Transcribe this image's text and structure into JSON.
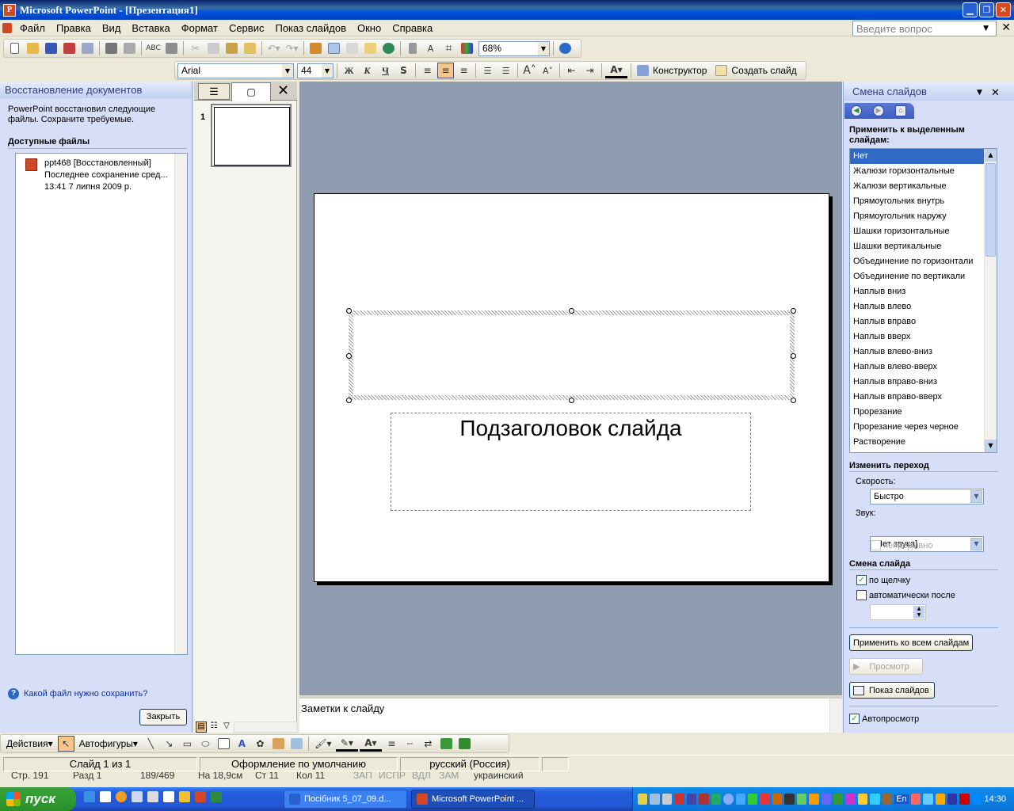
{
  "window": {
    "title": "Microsoft PowerPoint - [Презентация1]",
    "icon": "powerpoint-icon"
  },
  "menu": [
    "Файл",
    "Правка",
    "Вид",
    "Вставка",
    "Формат",
    "Сервис",
    "Показ слайдов",
    "Окно",
    "Справка"
  ],
  "ask": {
    "placeholder": "Введите вопрос"
  },
  "standard_toolbar": {
    "zoom": "68%"
  },
  "format_toolbar": {
    "font": "Arial",
    "size": "44",
    "bold": "Ж",
    "italic": "К",
    "underline": "Ч",
    "shadow": "S",
    "designer": "Конструктор",
    "new_slide": "Создать слайд"
  },
  "recovery": {
    "title": "Восстановление документов",
    "message": "PowerPoint восстановил следующие файлы. Сохраните требуемые.",
    "files_heading": "Доступные файлы",
    "file": {
      "name": "ppt468  [Восстановленный]",
      "line2": "Последнее сохранение сред...",
      "line3": "13:41 7 липня 2009 р."
    },
    "help_link": "Какой файл нужно сохранить?",
    "close": "Закрыть"
  },
  "slides_tab": {
    "slide_number": "1"
  },
  "slide": {
    "subtitle": "Подзаголовок слайда"
  },
  "notes": {
    "placeholder": "Заметки к слайду"
  },
  "transition": {
    "title": "Смена слайдов",
    "apply_heading": "Применить к выделенным слайдам:",
    "effects": [
      "Нет",
      "Жалюзи горизонтальные",
      "Жалюзи вертикальные",
      "Прямоугольник внутрь",
      "Прямоугольник наружу",
      "Шашки горизонтальные",
      "Шашки вертикальные",
      "Объединение по горизонтали",
      "Объединение по вертикали",
      "Наплыв вниз",
      "Наплыв влево",
      "Наплыв вправо",
      "Наплыв вверх",
      "Наплыв влево-вниз",
      "Наплыв влево-вверх",
      "Наплыв вправо-вниз",
      "Наплыв вправо-вверх",
      "Прорезание",
      "Прорезание через черное",
      "Растворение"
    ],
    "selected_effect": "Нет",
    "modify_heading": "Изменить переход",
    "speed_label": "Скорость:",
    "speed": "Быстро",
    "sound_label": "Звук:",
    "sound": "[Нет звука]",
    "loop_label": "непрерывно",
    "advance_heading": "Смена слайда",
    "on_click_label": "по щелчку",
    "on_click": true,
    "auto_label": "автоматически после",
    "auto": false,
    "apply_all": "Применить ко всем слайдам",
    "preview": "Просмотр",
    "slideshow": "Показ слайдов",
    "autopreview_label": "Автопросмотр",
    "autopreview": true
  },
  "drawing_toolbar": {
    "actions": "Действия",
    "autoshapes": "Автофигуры"
  },
  "status": {
    "slide": "Слайд 1 из 1",
    "design": "Оформление по умолчанию",
    "language": "русский (Россия)"
  },
  "status_behind": {
    "s1": "Стр. 191",
    "s2": "Разд 1",
    "s3": "189/469",
    "s4": "На 18,9см",
    "s5": "Ст 11",
    "s6": "Кол 11",
    "s7": "ЗАП",
    "s8": "ИСПР",
    "s9": "ВДЛ",
    "s10": "ЗАМ",
    "s11": "украинский"
  },
  "taskbar": {
    "start": "пуск",
    "tasks": [
      "Посібник 5_07_09.d...",
      "Microsoft PowerPoint ..."
    ],
    "lang": "En",
    "clock": "14:30"
  }
}
